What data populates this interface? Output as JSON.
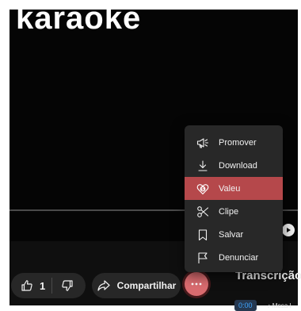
{
  "video": {
    "title_overlay": "karaoke"
  },
  "actions": {
    "like_count": "1",
    "share_label": "Compartilhar",
    "more_label": "···"
  },
  "more_menu": {
    "items": [
      {
        "label": "Promover",
        "icon": "megaphone-icon"
      },
      {
        "label": "Download",
        "icon": "download-icon"
      },
      {
        "label": "Valeu",
        "icon": "thanks-icon",
        "highlighted": true
      },
      {
        "label": "Clipe",
        "icon": "scissors-icon"
      },
      {
        "label": "Salvar",
        "icon": "bookmark-icon"
      },
      {
        "label": "Denunciar",
        "icon": "flag-icon"
      }
    ]
  },
  "transcript": {
    "title": "Transcrição",
    "first_time": "0:00",
    "first_text": "♪ Mesa I"
  },
  "colors": {
    "video_bg": "#050505",
    "menu_bg": "#282828",
    "highlight": "#b5484b",
    "more_button": "#d96b6f"
  }
}
